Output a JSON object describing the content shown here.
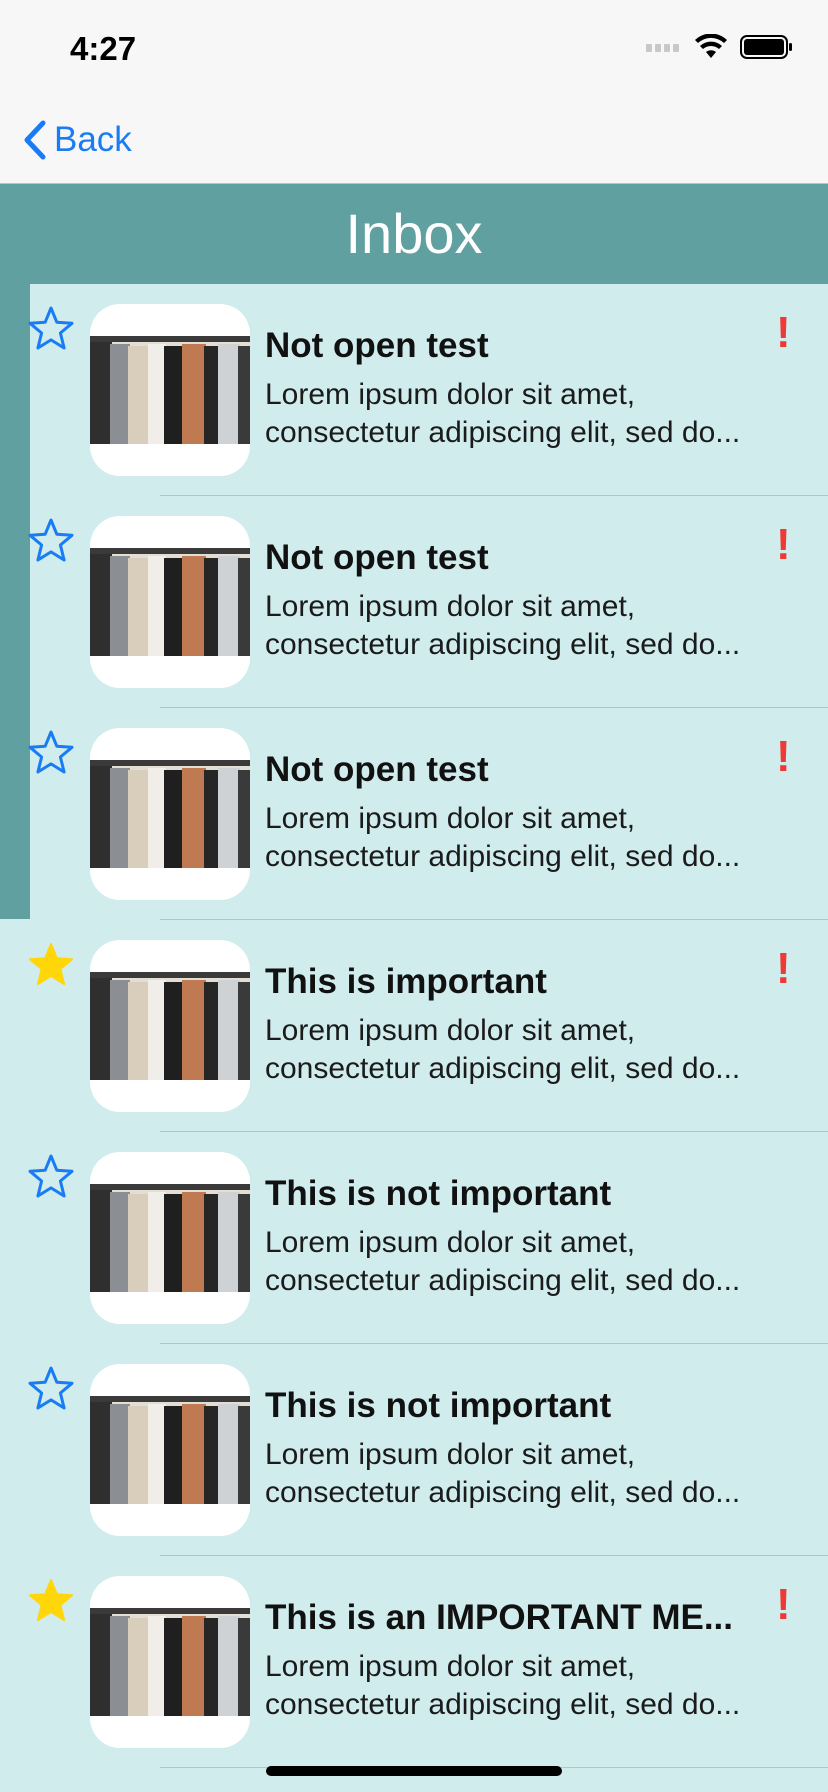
{
  "status_bar": {
    "time": "4:27"
  },
  "nav": {
    "back_label": "Back"
  },
  "header": {
    "title": "Inbox"
  },
  "messages": [
    {
      "title": "Not open test",
      "line1": "Lorem ipsum dolor sit amet,",
      "line2": "consectetur adipiscing elit, sed do...",
      "starred": false,
      "important_mark": "!"
    },
    {
      "title": "Not open test",
      "line1": "Lorem ipsum dolor sit amet,",
      "line2": "consectetur adipiscing elit, sed do...",
      "starred": false,
      "important_mark": "!"
    },
    {
      "title": "Not open test",
      "line1": "Lorem ipsum dolor sit amet,",
      "line2": "consectetur adipiscing elit, sed do...",
      "starred": false,
      "important_mark": "!"
    },
    {
      "title": "This is important",
      "line1": "Lorem ipsum dolor sit amet,",
      "line2": "consectetur adipiscing elit, sed do...",
      "starred": true,
      "important_mark": "!"
    },
    {
      "title": "This is not important",
      "line1": "Lorem ipsum dolor sit amet,",
      "line2": "consectetur adipiscing elit, sed do...",
      "starred": false,
      "important_mark": ""
    },
    {
      "title": "This is not important",
      "line1": "Lorem ipsum dolor sit amet,",
      "line2": "consectetur adipiscing elit, sed do...",
      "starred": false,
      "important_mark": ""
    },
    {
      "title": "This is an IMPORTANT ME...",
      "line1": "Lorem ipsum dolor sit amet,",
      "line2": "consectetur adipiscing elit, sed do...",
      "starred": true,
      "important_mark": "!"
    }
  ],
  "colors": {
    "accent": "#1a7cf5",
    "header_bg": "#61a0a0",
    "list_bg": "#d0eced",
    "star_filled": "#ffd60a",
    "alert": "#ee3a34"
  }
}
